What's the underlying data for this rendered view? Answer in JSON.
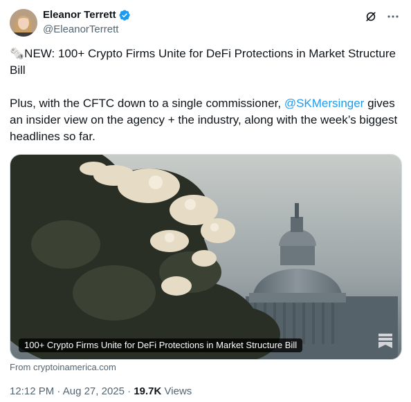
{
  "author": {
    "name": "Eleanor Terrett",
    "handle": "@EleanorTerrett",
    "verified_icon": "verified-badge-icon"
  },
  "tweet": {
    "headline": "🗞️NEW: 100+ Crypto Firms Unite for DeFi Protections in Market Structure Bill",
    "body_pre": "Plus, with the CFTC down to a single commissioner, ",
    "mention": "@SKMersinger",
    "body_post": " gives an insider view on the agency + the industry, along with the week’s biggest headlines so far."
  },
  "card": {
    "title": "100+ Crypto Firms Unite for DeFi Protections in Market Structure Bill",
    "source": "From cryptoinamerica.com"
  },
  "meta": {
    "time": "12:12 PM",
    "separator": "·",
    "date": "Aug 27, 2025",
    "views_count": "19.7K",
    "views_label": "Views"
  },
  "colors": {
    "accent": "#1d9bf0",
    "secondary_text": "#536471",
    "primary_text": "#0f1419"
  }
}
